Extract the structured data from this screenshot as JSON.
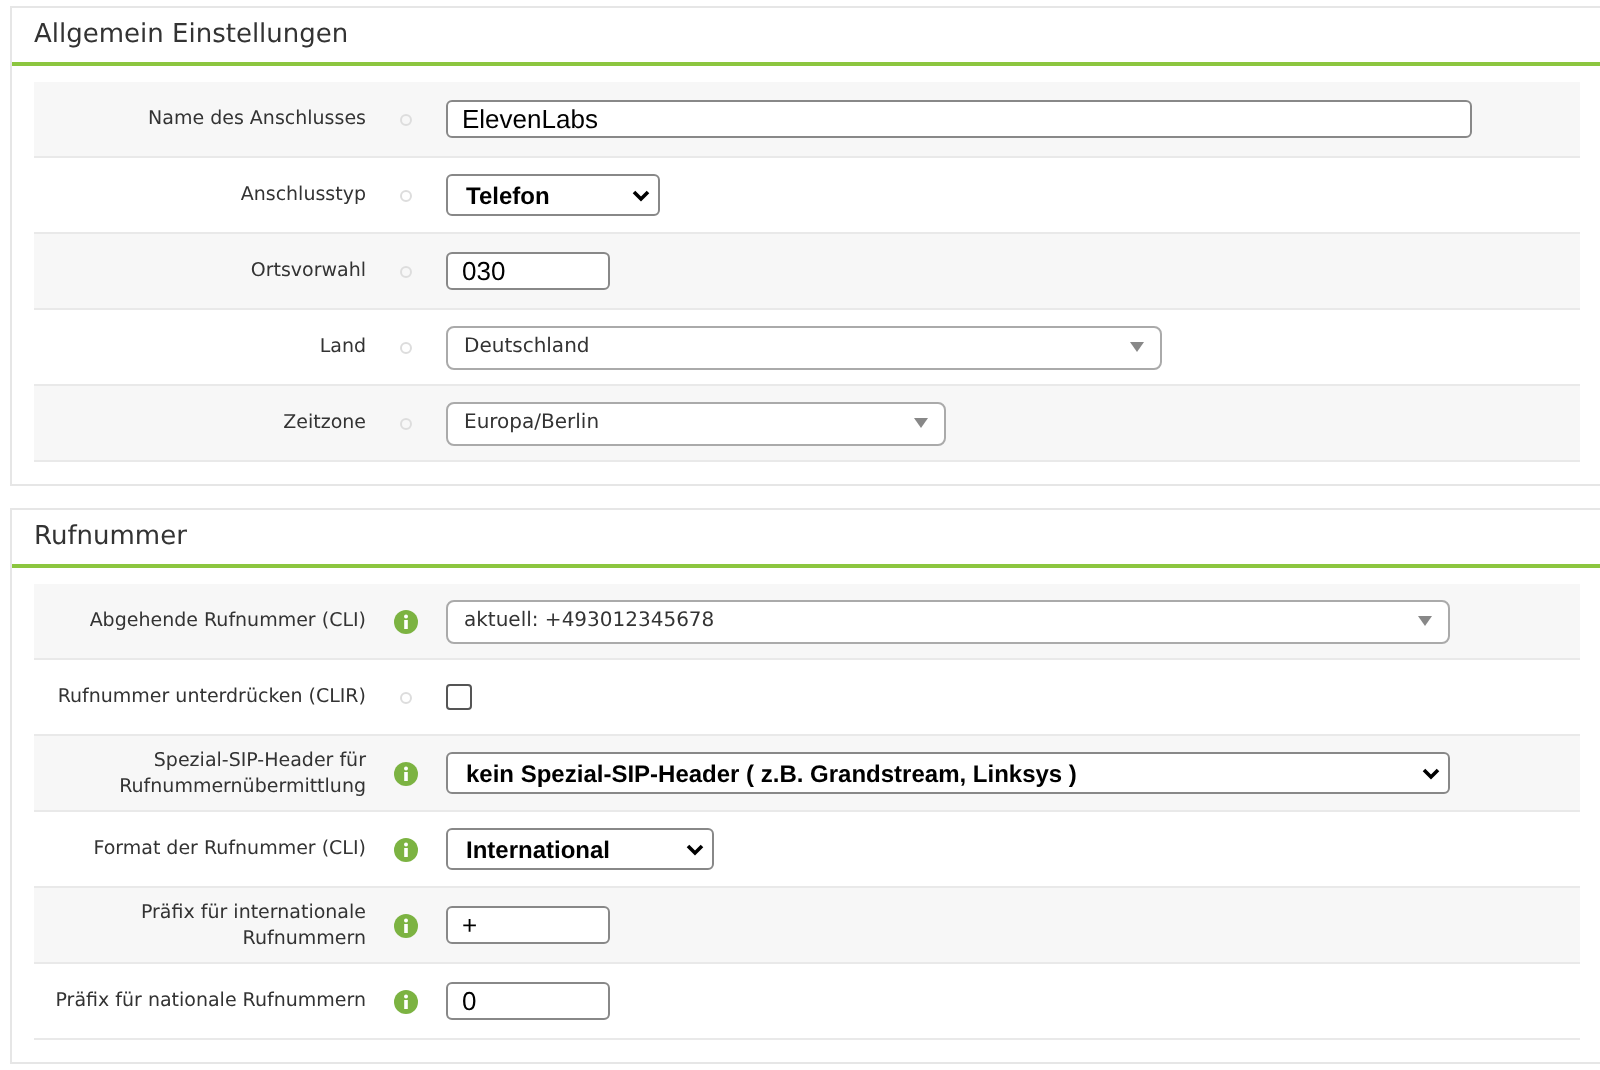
{
  "panels": [
    {
      "title": "Allgemein Einstellungen",
      "rows": [
        {
          "label": "Name des Anschlusses",
          "info": false,
          "kind": "input",
          "value": "ElevenLabs"
        },
        {
          "label": "Anschlusstyp",
          "info": false,
          "kind": "native-select",
          "value": "Telefon"
        },
        {
          "label": "Ortsvorwahl",
          "info": false,
          "kind": "input",
          "value": "030"
        },
        {
          "label": "Land",
          "info": false,
          "kind": "styled-select",
          "value": "Deutschland"
        },
        {
          "label": "Zeitzone",
          "info": false,
          "kind": "styled-select",
          "value": "Europa/Berlin"
        }
      ]
    },
    {
      "title": "Rufnummer",
      "rows": [
        {
          "label": "Abgehende Rufnummer (CLI)",
          "info": true,
          "kind": "styled-select",
          "value": "aktuell: +493012345678"
        },
        {
          "label": "Rufnummer unterdrücken (CLIR)",
          "info": false,
          "kind": "checkbox",
          "checked": false
        },
        {
          "label": "Spezial-SIP-Header für Rufnummernübermittlung",
          "info": true,
          "kind": "native-select",
          "value": "kein Spezial-SIP-Header ( z.B. Grandstream, Linksys )"
        },
        {
          "label": "Format der Rufnummer (CLI)",
          "info": true,
          "kind": "native-select",
          "value": "International"
        },
        {
          "label": "Präfix für internationale Rufnummern",
          "info": true,
          "kind": "input",
          "value": "+"
        },
        {
          "label": "Präfix für nationale Rufnummern",
          "info": true,
          "kind": "input",
          "value": "0"
        }
      ]
    }
  ]
}
